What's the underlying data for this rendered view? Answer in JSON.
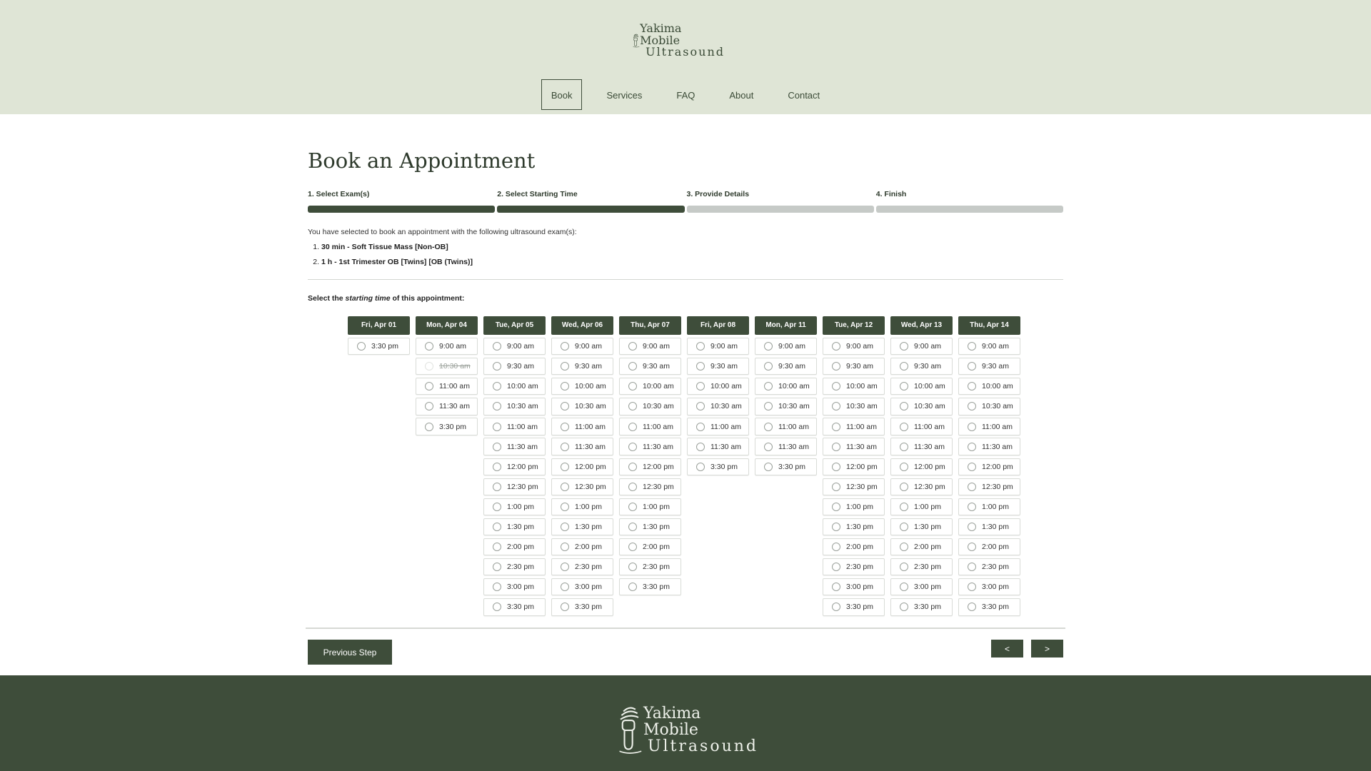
{
  "brand": {
    "line1": "Yakima Mobile",
    "line2": "Ultrasound"
  },
  "nav": [
    {
      "label": "Book",
      "active": true
    },
    {
      "label": "Services",
      "active": false
    },
    {
      "label": "FAQ",
      "active": false
    },
    {
      "label": "About",
      "active": false
    },
    {
      "label": "Contact",
      "active": false
    }
  ],
  "page_title": "Book an Appointment",
  "steps": [
    {
      "label": "1. Select Exam(s)",
      "done": true
    },
    {
      "label": "2. Select Starting Time",
      "done": true
    },
    {
      "label": "3. Provide Details",
      "done": false
    },
    {
      "label": "4. Finish",
      "done": false
    }
  ],
  "intro": "You have selected to book an appointment with the following ultrasound exam(s):",
  "exams": [
    {
      "num": "1.",
      "text": "30 min - Soft Tissue Mass [Non-OB]"
    },
    {
      "num": "2.",
      "text": "1 h - 1st Trimester OB [Twins] [OB (Twins)]"
    }
  ],
  "select_label": {
    "before": "Select the ",
    "emphasis": "starting time",
    "after": " of this appointment:"
  },
  "days": [
    {
      "label": "Fri, Apr 01",
      "slots": [
        "3:30 pm"
      ]
    },
    {
      "label": "Mon, Apr 04",
      "slots": [
        "9:00 am",
        "10:30 am",
        "11:00 am",
        "11:30 am",
        "3:30 pm"
      ],
      "disabled": [
        "10:30 am"
      ]
    },
    {
      "label": "Tue, Apr 05",
      "slots": [
        "9:00 am",
        "9:30 am",
        "10:00 am",
        "10:30 am",
        "11:00 am",
        "11:30 am",
        "12:00 pm",
        "12:30 pm",
        "1:00 pm",
        "1:30 pm",
        "2:00 pm",
        "2:30 pm",
        "3:00 pm",
        "3:30 pm"
      ]
    },
    {
      "label": "Wed, Apr 06",
      "slots": [
        "9:00 am",
        "9:30 am",
        "10:00 am",
        "10:30 am",
        "11:00 am",
        "11:30 am",
        "12:00 pm",
        "12:30 pm",
        "1:00 pm",
        "1:30 pm",
        "2:00 pm",
        "2:30 pm",
        "3:00 pm",
        "3:30 pm"
      ]
    },
    {
      "label": "Thu, Apr 07",
      "slots": [
        "9:00 am",
        "9:30 am",
        "10:00 am",
        "10:30 am",
        "11:00 am",
        "11:30 am",
        "12:00 pm",
        "12:30 pm",
        "1:00 pm",
        "1:30 pm",
        "2:00 pm",
        "2:30 pm",
        "3:30 pm"
      ]
    },
    {
      "label": "Fri, Apr 08",
      "slots": [
        "9:00 am",
        "9:30 am",
        "10:00 am",
        "10:30 am",
        "11:00 am",
        "11:30 am",
        "3:30 pm"
      ]
    },
    {
      "label": "Mon, Apr 11",
      "slots": [
        "9:00 am",
        "9:30 am",
        "10:00 am",
        "10:30 am",
        "11:00 am",
        "11:30 am",
        "3:30 pm"
      ]
    },
    {
      "label": "Tue, Apr 12",
      "slots": [
        "9:00 am",
        "9:30 am",
        "10:00 am",
        "10:30 am",
        "11:00 am",
        "11:30 am",
        "12:00 pm",
        "12:30 pm",
        "1:00 pm",
        "1:30 pm",
        "2:00 pm",
        "2:30 pm",
        "3:00 pm",
        "3:30 pm"
      ]
    },
    {
      "label": "Wed, Apr 13",
      "slots": [
        "9:00 am",
        "9:30 am",
        "10:00 am",
        "10:30 am",
        "11:00 am",
        "11:30 am",
        "12:00 pm",
        "12:30 pm",
        "1:00 pm",
        "1:30 pm",
        "2:00 pm",
        "2:30 pm",
        "3:00 pm",
        "3:30 pm"
      ]
    },
    {
      "label": "Thu, Apr 14",
      "slots": [
        "9:00 am",
        "9:30 am",
        "10:00 am",
        "10:30 am",
        "11:00 am",
        "11:30 am",
        "12:00 pm",
        "12:30 pm",
        "1:00 pm",
        "1:30 pm",
        "2:00 pm",
        "2:30 pm",
        "3:00 pm",
        "3:30 pm"
      ]
    }
  ],
  "buttons": {
    "previous_step": "Previous Step",
    "prev_page": "<",
    "next_page": ">"
  },
  "colors": {
    "header_bg": "#dfe5d6",
    "accent": "#3e4d3a",
    "progress_pending": "#c6cac7"
  },
  "icons": {
    "logo": "ultrasound-probe-icon"
  }
}
